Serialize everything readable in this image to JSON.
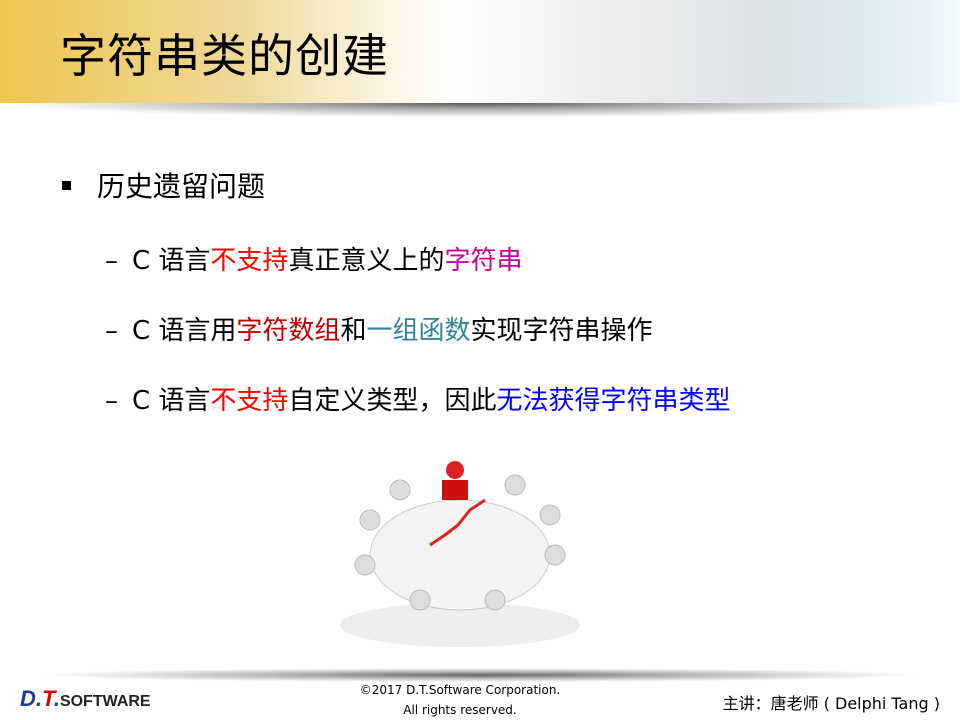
{
  "title": "字符串类的创建",
  "bullet": "历史遗留问题",
  "items": [
    {
      "dash": "–",
      "parts": [
        {
          "text": "C 语言",
          "color": "#000000"
        },
        {
          "text": "不支持",
          "color": "#ff0000"
        },
        {
          "text": "真正意义上的",
          "color": "#000000"
        },
        {
          "text": "字符串",
          "color": "#cc0099"
        }
      ]
    },
    {
      "dash": "–",
      "parts": [
        {
          "text": "C 语言用",
          "color": "#000000"
        },
        {
          "text": "字符数组",
          "color": "#c00000"
        },
        {
          "text": "和",
          "color": "#000000"
        },
        {
          "text": "一组函数",
          "color": "#31849b"
        },
        {
          "text": "实现字符串操作",
          "color": "#000000"
        }
      ]
    },
    {
      "dash": "–",
      "parts": [
        {
          "text": "C 语言",
          "color": "#000000"
        },
        {
          "text": "不支持",
          "color": "#ff0000"
        },
        {
          "text": "自定义类型，因此",
          "color": "#000000"
        },
        {
          "text": "无法获得字符串类型",
          "color": "#0000ff"
        }
      ]
    }
  ],
  "footer": {
    "logo": "D.T.SOFTWARE",
    "copyright_line1": "©2017 D.T.Software Corporation.",
    "copyright_line2": "All rights reserved.",
    "lecturer": "主讲：唐老师 ( Delphi Tang )"
  }
}
